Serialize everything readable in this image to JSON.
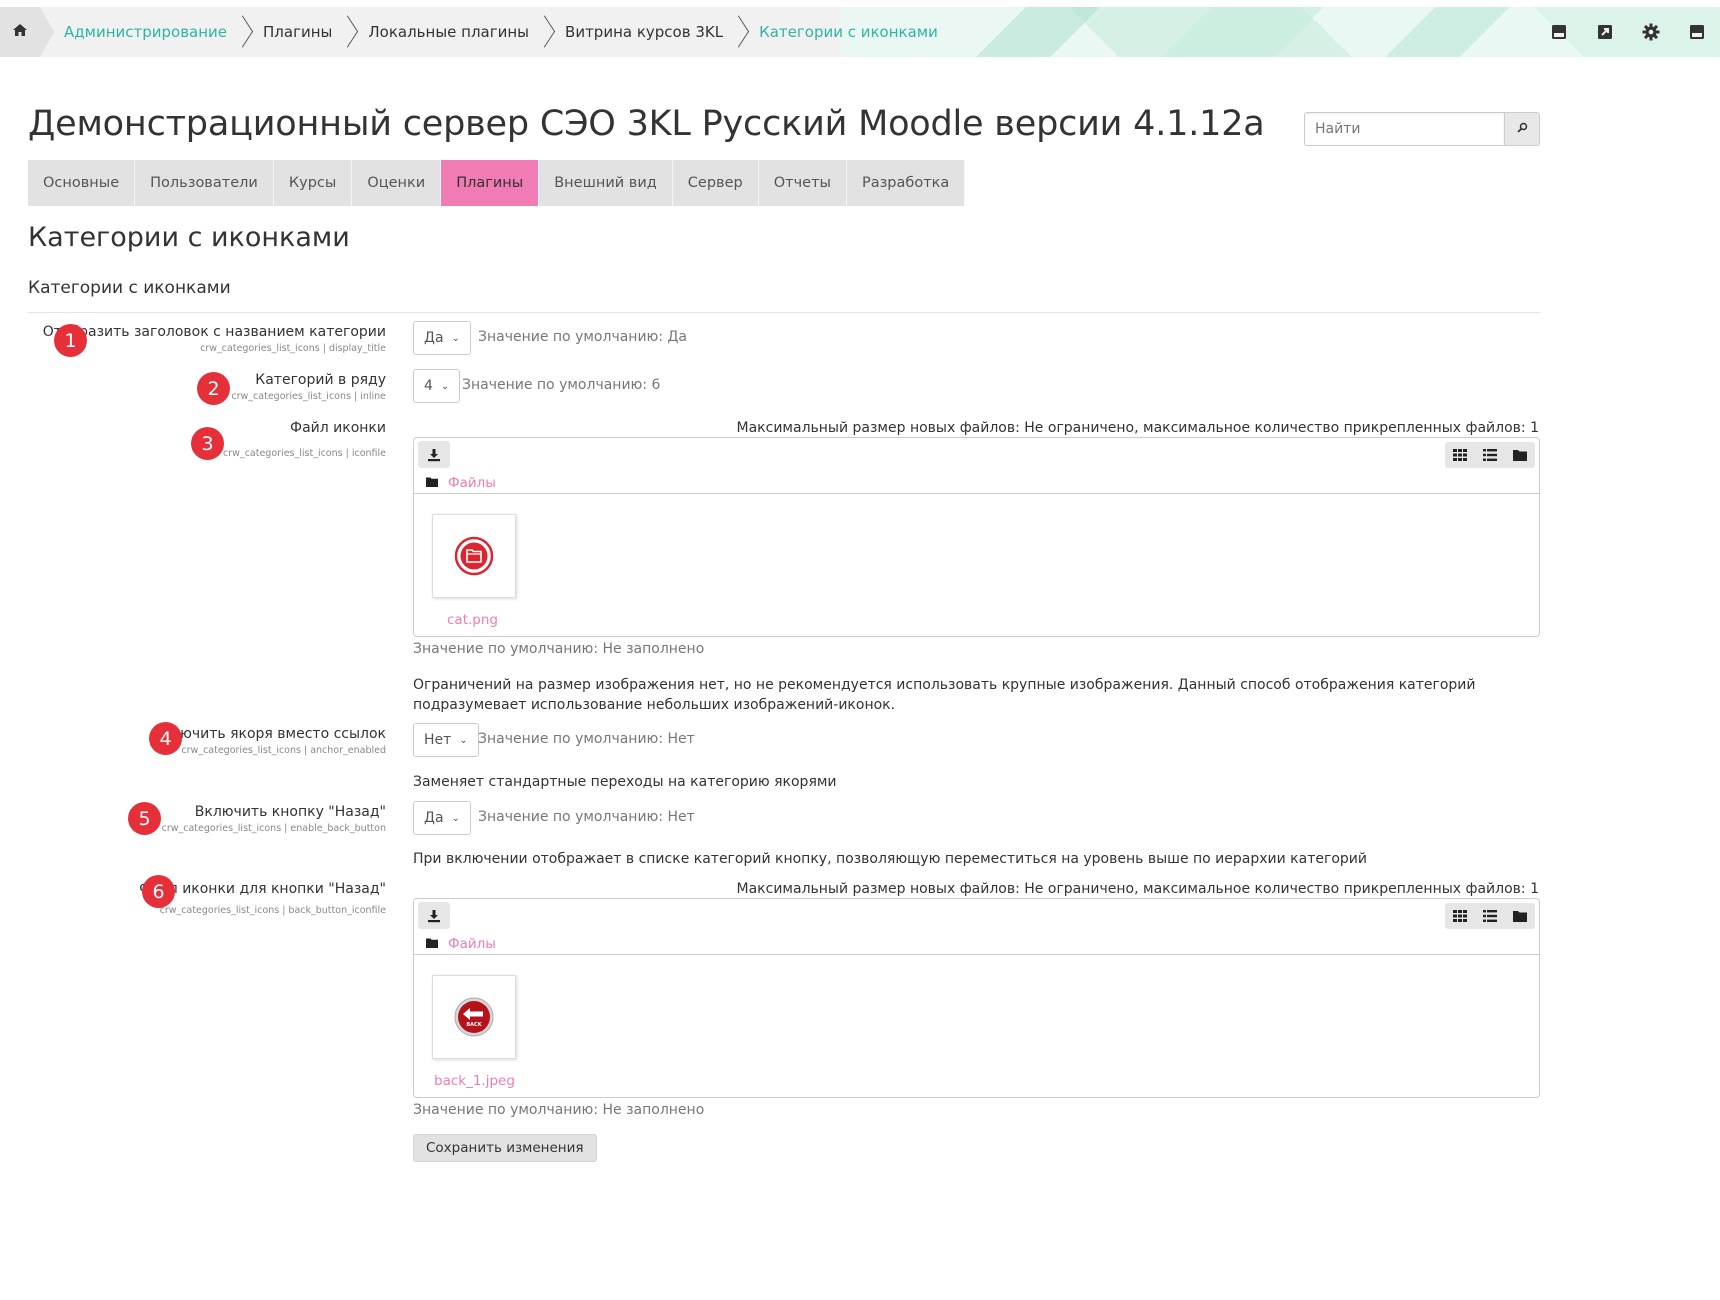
{
  "breadcrumb": {
    "items": [
      {
        "label": "Администрирование",
        "link": true
      },
      {
        "label": "Плагины",
        "link": false
      },
      {
        "label": "Локальные плагины",
        "link": false
      },
      {
        "label": "Витрина курсов 3KL",
        "link": false
      },
      {
        "label": "Категории с иконками",
        "link": true
      }
    ]
  },
  "header": {
    "site_title": "Демонстрационный сервер СЭО 3KL Русский Moodle версии 4.1.12a",
    "search_placeholder": "Найти"
  },
  "tabs": [
    {
      "label": "Основные"
    },
    {
      "label": "Пользователи"
    },
    {
      "label": "Курсы"
    },
    {
      "label": "Оценки"
    },
    {
      "label": "Плагины",
      "active": true
    },
    {
      "label": "Внешний вид"
    },
    {
      "label": "Сервер"
    },
    {
      "label": "Отчеты"
    },
    {
      "label": "Разработка"
    }
  ],
  "page_heading": "Категории с иконками",
  "section_heading": "Категории с иконками",
  "settings": {
    "s1": {
      "badge": "1",
      "title": "Отобразить заголовок с названием категории",
      "key": "crw_categories_list_icons | display_title",
      "value": "Да",
      "default": "Значение по умолчанию: Да"
    },
    "s2": {
      "badge": "2",
      "title": "Категорий в ряду",
      "key": "crw_categories_list_icons | inline",
      "value": "4",
      "default": "Значение по умолчанию: 6"
    },
    "s3": {
      "badge": "3",
      "title": "Файл иконки",
      "key": "crw_categories_list_icons | iconfile",
      "limits": "Максимальный размер новых файлов: Не ограничено, максимальное количество прикрепленных файлов: 1",
      "folder": "Файлы",
      "file": "cat.png",
      "default": "Значение по умолчанию: Не заполнено",
      "description": "Ограничений на размер изображения нет, но не рекомендуется использовать крупные изображения. Данный способ отображения категорий подразумевает использование небольших изображений-иконок."
    },
    "s4": {
      "badge": "4",
      "title": "Включить якоря вместо ссылок",
      "key": "crw_categories_list_icons | anchor_enabled",
      "value": "Нет",
      "default": "Значение по умолчанию: Нет",
      "description": "Заменяет стандартные переходы на категорию якорями"
    },
    "s5": {
      "badge": "5",
      "title": "Включить кнопку \"Назад\"",
      "key": "crw_categories_list_icons | enable_back_button",
      "value": "Да",
      "default": "Значение по умолчанию: Нет",
      "description": "При включении отображает в списке категорий кнопку, позволяющую переместиться на уровень выше по иерархии категорий"
    },
    "s6": {
      "badge": "6",
      "title": "Файл иконки для кнопки \"Назад\"",
      "key": "crw_categories_list_icons | back_button_iconfile",
      "limits": "Максимальный размер новых файлов: Не ограничено, максимальное количество прикрепленных файлов: 1",
      "folder": "Файлы",
      "file": "back_1.jpeg",
      "default": "Значение по умолчанию: Не заполнено",
      "thumb_text": "BACK"
    }
  },
  "save_label": "Сохранить изменения",
  "icons": {
    "home": "home-icon",
    "top": [
      "save-icon",
      "share-icon",
      "gear-icon",
      "save-icon-2"
    ],
    "download": "download-icon",
    "views": [
      "grid-icon",
      "list-icon",
      "folder-icon"
    ]
  },
  "colors": {
    "accent_pink": "#f07bb5",
    "accent_teal": "#2bb6a3",
    "badge_red": "#e5303a"
  }
}
